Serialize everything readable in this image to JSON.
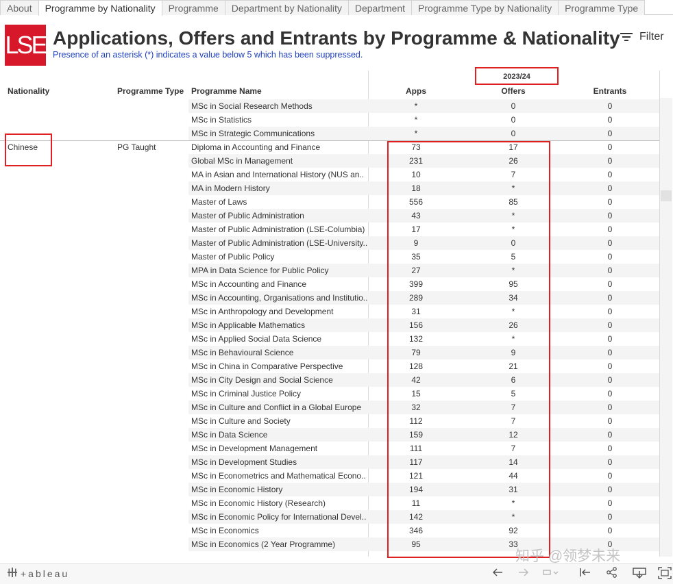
{
  "tabs": [
    "About",
    "Programme by Nationality",
    "Programme",
    "Department by Nationality",
    "Department",
    "Programme Type by Nationality",
    "Programme Type"
  ],
  "active_tab": 1,
  "header": {
    "logo_text": "LSE",
    "title": "Applications, Offers and Entrants by Programme & Nationality",
    "subtitle": "Presence of an asterisk (*) indicates a value below 5 which has been suppressed.",
    "filter_label": "Filter"
  },
  "table": {
    "year": "2023/24",
    "col_nationality": "Nationality",
    "col_programme_type": "Programme Type",
    "col_programme_name": "Programme Name",
    "col_apps": "Apps",
    "col_offers": "Offers",
    "col_entrants": "Entrants",
    "nationality": "Chinese",
    "programme_type": "PG Taught",
    "rows": [
      {
        "name": "MSc in Social Research Methods",
        "apps": "*",
        "offers": "0",
        "entrants": "0"
      },
      {
        "name": "MSc in Statistics",
        "apps": "*",
        "offers": "0",
        "entrants": "0"
      },
      {
        "name": "MSc in Strategic Communications",
        "apps": "*",
        "offers": "0",
        "entrants": "0"
      },
      {
        "name": "Diploma in Accounting and Finance",
        "apps": "73",
        "offers": "17",
        "entrants": "0"
      },
      {
        "name": "Global MSc in Management",
        "apps": "231",
        "offers": "26",
        "entrants": "0"
      },
      {
        "name": "MA in Asian and International History (NUS an..",
        "apps": "10",
        "offers": "7",
        "entrants": "0"
      },
      {
        "name": "MA in Modern History",
        "apps": "18",
        "offers": "*",
        "entrants": "0"
      },
      {
        "name": "Master of Laws",
        "apps": "556",
        "offers": "85",
        "entrants": "0"
      },
      {
        "name": "Master of Public Administration",
        "apps": "43",
        "offers": "*",
        "entrants": "0"
      },
      {
        "name": "Master of Public Administration (LSE-Columbia)",
        "apps": "17",
        "offers": "*",
        "entrants": "0"
      },
      {
        "name": "Master of Public Administration (LSE-University..",
        "apps": "9",
        "offers": "0",
        "entrants": "0"
      },
      {
        "name": "Master of Public Policy",
        "apps": "35",
        "offers": "5",
        "entrants": "0"
      },
      {
        "name": "MPA in Data Science for Public Policy",
        "apps": "27",
        "offers": "*",
        "entrants": "0"
      },
      {
        "name": "MSc in Accounting and Finance",
        "apps": "399",
        "offers": "95",
        "entrants": "0"
      },
      {
        "name": "MSc in Accounting, Organisations and Institutio..",
        "apps": "289",
        "offers": "34",
        "entrants": "0"
      },
      {
        "name": "MSc in Anthropology and Development",
        "apps": "31",
        "offers": "*",
        "entrants": "0"
      },
      {
        "name": "MSc in Applicable Mathematics",
        "apps": "156",
        "offers": "26",
        "entrants": "0"
      },
      {
        "name": "MSc in Applied Social Data Science",
        "apps": "132",
        "offers": "*",
        "entrants": "0"
      },
      {
        "name": "MSc in Behavioural Science",
        "apps": "79",
        "offers": "9",
        "entrants": "0"
      },
      {
        "name": "MSc in China in Comparative Perspective",
        "apps": "128",
        "offers": "21",
        "entrants": "0"
      },
      {
        "name": "MSc in City Design and Social Science",
        "apps": "42",
        "offers": "6",
        "entrants": "0"
      },
      {
        "name": "MSc in Criminal Justice Policy",
        "apps": "15",
        "offers": "5",
        "entrants": "0"
      },
      {
        "name": "MSc in Culture and Conflict in a Global Europe",
        "apps": "32",
        "offers": "7",
        "entrants": "0"
      },
      {
        "name": "MSc in Culture and Society",
        "apps": "112",
        "offers": "7",
        "entrants": "0"
      },
      {
        "name": "MSc in Data Science",
        "apps": "159",
        "offers": "12",
        "entrants": "0"
      },
      {
        "name": "MSc in Development Management",
        "apps": "111",
        "offers": "7",
        "entrants": "0"
      },
      {
        "name": "MSc in Development Studies",
        "apps": "117",
        "offers": "14",
        "entrants": "0"
      },
      {
        "name": "MSc in Econometrics and Mathematical Econo..",
        "apps": "121",
        "offers": "44",
        "entrants": "0"
      },
      {
        "name": "MSc in Economic History",
        "apps": "194",
        "offers": "31",
        "entrants": "0"
      },
      {
        "name": "MSc in Economic History (Research)",
        "apps": "11",
        "offers": "*",
        "entrants": "0"
      },
      {
        "name": "MSc in Economic Policy for International Devel..",
        "apps": "142",
        "offers": "*",
        "entrants": "0"
      },
      {
        "name": "MSc in Economics",
        "apps": "346",
        "offers": "92",
        "entrants": "0"
      },
      {
        "name": "MSc in Economics (2 Year Programme)",
        "apps": "95",
        "offers": "33",
        "entrants": "0"
      }
    ]
  },
  "footer": {
    "brand": "+ableau",
    "watermark": "知乎 @领梦未来"
  },
  "icons": {
    "filter": "filter-icon",
    "undo": "undo-icon",
    "redo": "redo-icon",
    "revert": "revert-icon",
    "reset": "reset-icon",
    "share": "share-icon",
    "download": "download-icon",
    "fullscreen": "fullscreen-icon"
  },
  "colors": {
    "lse_red": "#d7182a",
    "highlight_red": "#e02020",
    "subtitle_blue": "#1f3fbf"
  }
}
